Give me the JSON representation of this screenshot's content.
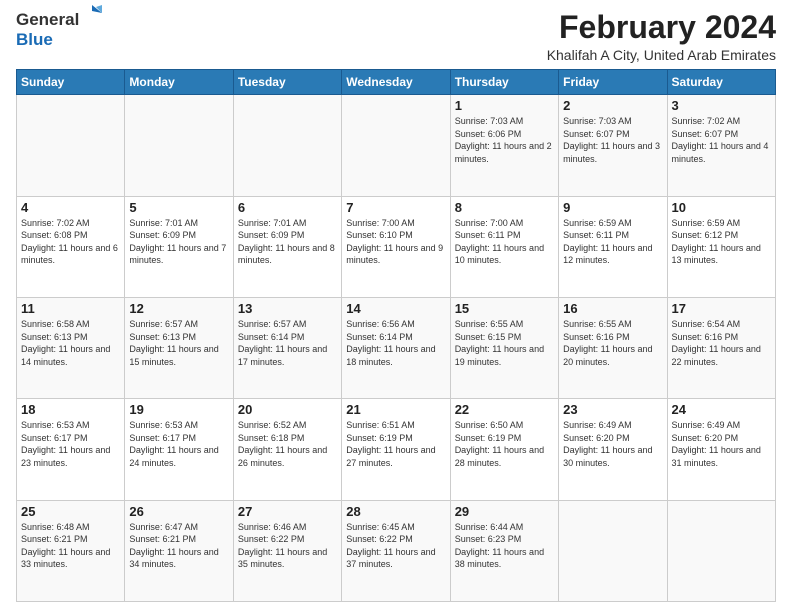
{
  "header": {
    "logo_line1": "General",
    "logo_line2": "Blue",
    "month": "February 2024",
    "location": "Khalifah A City, United Arab Emirates"
  },
  "days_of_week": [
    "Sunday",
    "Monday",
    "Tuesday",
    "Wednesday",
    "Thursday",
    "Friday",
    "Saturday"
  ],
  "weeks": [
    [
      {
        "day": "",
        "info": ""
      },
      {
        "day": "",
        "info": ""
      },
      {
        "day": "",
        "info": ""
      },
      {
        "day": "",
        "info": ""
      },
      {
        "day": "1",
        "info": "Sunrise: 7:03 AM\nSunset: 6:06 PM\nDaylight: 11 hours and 2 minutes."
      },
      {
        "day": "2",
        "info": "Sunrise: 7:03 AM\nSunset: 6:07 PM\nDaylight: 11 hours and 3 minutes."
      },
      {
        "day": "3",
        "info": "Sunrise: 7:02 AM\nSunset: 6:07 PM\nDaylight: 11 hours and 4 minutes."
      }
    ],
    [
      {
        "day": "4",
        "info": "Sunrise: 7:02 AM\nSunset: 6:08 PM\nDaylight: 11 hours and 6 minutes."
      },
      {
        "day": "5",
        "info": "Sunrise: 7:01 AM\nSunset: 6:09 PM\nDaylight: 11 hours and 7 minutes."
      },
      {
        "day": "6",
        "info": "Sunrise: 7:01 AM\nSunset: 6:09 PM\nDaylight: 11 hours and 8 minutes."
      },
      {
        "day": "7",
        "info": "Sunrise: 7:00 AM\nSunset: 6:10 PM\nDaylight: 11 hours and 9 minutes."
      },
      {
        "day": "8",
        "info": "Sunrise: 7:00 AM\nSunset: 6:11 PM\nDaylight: 11 hours and 10 minutes."
      },
      {
        "day": "9",
        "info": "Sunrise: 6:59 AM\nSunset: 6:11 PM\nDaylight: 11 hours and 12 minutes."
      },
      {
        "day": "10",
        "info": "Sunrise: 6:59 AM\nSunset: 6:12 PM\nDaylight: 11 hours and 13 minutes."
      }
    ],
    [
      {
        "day": "11",
        "info": "Sunrise: 6:58 AM\nSunset: 6:13 PM\nDaylight: 11 hours and 14 minutes."
      },
      {
        "day": "12",
        "info": "Sunrise: 6:57 AM\nSunset: 6:13 PM\nDaylight: 11 hours and 15 minutes."
      },
      {
        "day": "13",
        "info": "Sunrise: 6:57 AM\nSunset: 6:14 PM\nDaylight: 11 hours and 17 minutes."
      },
      {
        "day": "14",
        "info": "Sunrise: 6:56 AM\nSunset: 6:14 PM\nDaylight: 11 hours and 18 minutes."
      },
      {
        "day": "15",
        "info": "Sunrise: 6:55 AM\nSunset: 6:15 PM\nDaylight: 11 hours and 19 minutes."
      },
      {
        "day": "16",
        "info": "Sunrise: 6:55 AM\nSunset: 6:16 PM\nDaylight: 11 hours and 20 minutes."
      },
      {
        "day": "17",
        "info": "Sunrise: 6:54 AM\nSunset: 6:16 PM\nDaylight: 11 hours and 22 minutes."
      }
    ],
    [
      {
        "day": "18",
        "info": "Sunrise: 6:53 AM\nSunset: 6:17 PM\nDaylight: 11 hours and 23 minutes."
      },
      {
        "day": "19",
        "info": "Sunrise: 6:53 AM\nSunset: 6:17 PM\nDaylight: 11 hours and 24 minutes."
      },
      {
        "day": "20",
        "info": "Sunrise: 6:52 AM\nSunset: 6:18 PM\nDaylight: 11 hours and 26 minutes."
      },
      {
        "day": "21",
        "info": "Sunrise: 6:51 AM\nSunset: 6:19 PM\nDaylight: 11 hours and 27 minutes."
      },
      {
        "day": "22",
        "info": "Sunrise: 6:50 AM\nSunset: 6:19 PM\nDaylight: 11 hours and 28 minutes."
      },
      {
        "day": "23",
        "info": "Sunrise: 6:49 AM\nSunset: 6:20 PM\nDaylight: 11 hours and 30 minutes."
      },
      {
        "day": "24",
        "info": "Sunrise: 6:49 AM\nSunset: 6:20 PM\nDaylight: 11 hours and 31 minutes."
      }
    ],
    [
      {
        "day": "25",
        "info": "Sunrise: 6:48 AM\nSunset: 6:21 PM\nDaylight: 11 hours and 33 minutes."
      },
      {
        "day": "26",
        "info": "Sunrise: 6:47 AM\nSunset: 6:21 PM\nDaylight: 11 hours and 34 minutes."
      },
      {
        "day": "27",
        "info": "Sunrise: 6:46 AM\nSunset: 6:22 PM\nDaylight: 11 hours and 35 minutes."
      },
      {
        "day": "28",
        "info": "Sunrise: 6:45 AM\nSunset: 6:22 PM\nDaylight: 11 hours and 37 minutes."
      },
      {
        "day": "29",
        "info": "Sunrise: 6:44 AM\nSunset: 6:23 PM\nDaylight: 11 hours and 38 minutes."
      },
      {
        "day": "",
        "info": ""
      },
      {
        "day": "",
        "info": ""
      }
    ]
  ]
}
